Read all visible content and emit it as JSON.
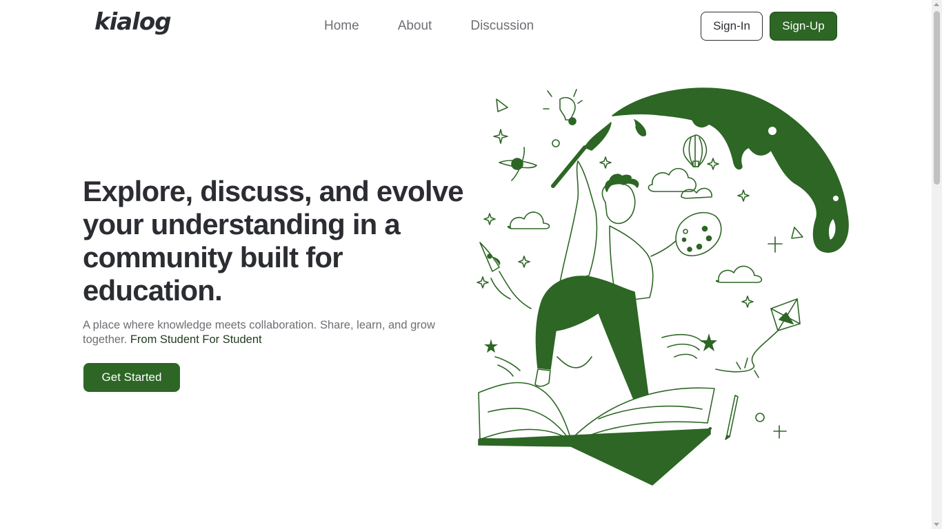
{
  "brand": {
    "logo_text": "kialog",
    "accent_color": "#2d6625"
  },
  "nav": {
    "links": [
      {
        "label": "Home"
      },
      {
        "label": "About"
      },
      {
        "label": "Discussion"
      }
    ],
    "signin_label": "Sign-In",
    "signup_label": "Sign-Up"
  },
  "hero": {
    "title": "Explore, discuss, and evolve your understanding in a community built for education.",
    "subtitle": "A place where knowledge meets collaboration. Share, learn, and grow together.",
    "tagline": "From Student For Student",
    "cta_label": "Get Started"
  },
  "illustration": {
    "icon": "student-painting-on-book-illustration"
  }
}
